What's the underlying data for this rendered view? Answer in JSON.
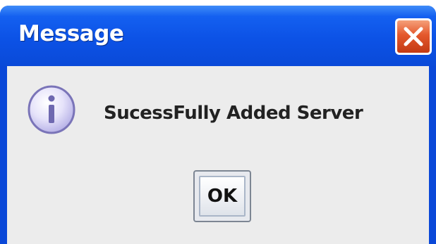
{
  "window": {
    "title": "Message"
  },
  "dialog": {
    "icon": "info-icon",
    "message": "SucessFully Added Server",
    "ok_label": "OK"
  },
  "colors": {
    "titlebar": "#0c52e6",
    "close_button": "#e4582c",
    "content_background": "#ececec"
  }
}
